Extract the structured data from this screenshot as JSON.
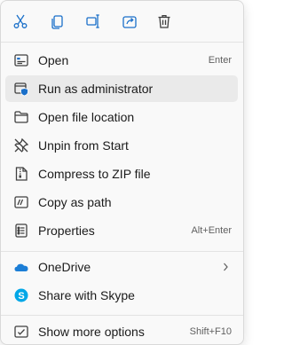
{
  "colors": {
    "accent": "#1a6fc9",
    "icon_gray": "#404040",
    "hover_bg": "#eaeaea",
    "onedrive": "#1c7ed6",
    "skype": "#00a7e7"
  },
  "toolbar": [
    {
      "name": "cut",
      "icon": "scissors-icon"
    },
    {
      "name": "copy",
      "icon": "copy-icon"
    },
    {
      "name": "rename",
      "icon": "rename-icon"
    },
    {
      "name": "share",
      "icon": "share-icon"
    },
    {
      "name": "delete",
      "icon": "trash-icon"
    }
  ],
  "items": [
    {
      "label": "Open",
      "shortcut": "Enter",
      "icon": "open-window-icon"
    },
    {
      "label": "Run as administrator",
      "shortcut": "",
      "icon": "admin-shield-icon"
    },
    {
      "label": "Open file location",
      "shortcut": "",
      "icon": "folder-icon"
    },
    {
      "label": "Unpin from Start",
      "shortcut": "",
      "icon": "unpin-icon"
    },
    {
      "label": "Compress to ZIP file",
      "shortcut": "",
      "icon": "zip-icon"
    },
    {
      "label": "Copy as path",
      "shortcut": "",
      "icon": "copy-path-icon"
    },
    {
      "label": "Properties",
      "shortcut": "Alt+Enter",
      "icon": "properties-icon"
    },
    {
      "label": "OneDrive",
      "shortcut": "",
      "icon": "onedrive-icon"
    },
    {
      "label": "Share with Skype",
      "shortcut": "",
      "icon": "skype-icon"
    },
    {
      "label": "Show more options",
      "shortcut": "Shift+F10",
      "icon": "more-options-icon"
    }
  ]
}
